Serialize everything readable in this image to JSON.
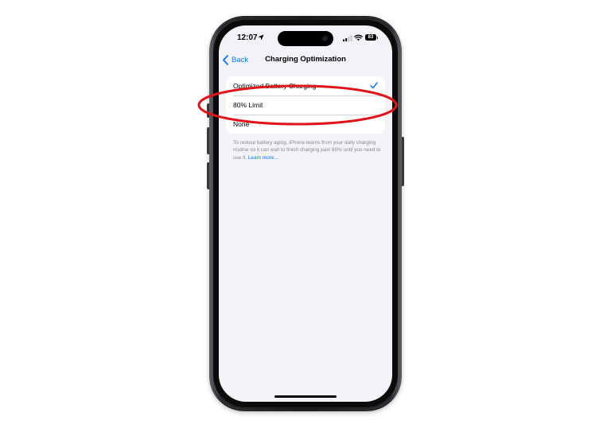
{
  "status_bar": {
    "time": "12:07",
    "battery_level": "83",
    "icons": [
      "location-arrow-icon",
      "cellular-signal-icon",
      "wifi-icon",
      "battery-icon"
    ]
  },
  "nav": {
    "back_label": "Back",
    "title": "Charging Optimization"
  },
  "options": [
    {
      "label": "Optimized Battery Charging",
      "selected": true
    },
    {
      "label": "80% Limit",
      "selected": false
    },
    {
      "label": "None",
      "selected": false
    }
  ],
  "footer": {
    "text": "To reduce battery aging, iPhone learns from your daily charging routine so it can wait to finish charging past 80% until you need to use it.",
    "link": "Learn more..."
  },
  "colors": {
    "accent": "#0a7aff",
    "background": "#f2f2f7",
    "annotation": "#e0151b"
  }
}
